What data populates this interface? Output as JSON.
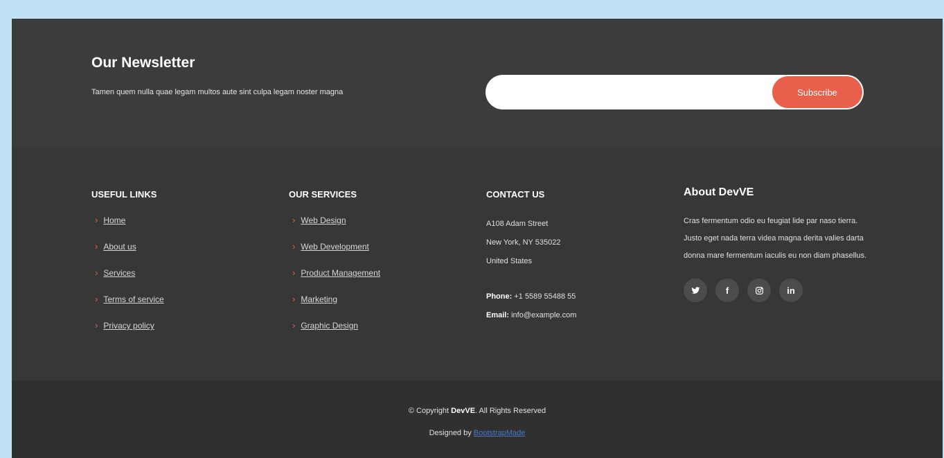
{
  "newsletter": {
    "title": "Our Newsletter",
    "text": "Tamen quem nulla quae legam multos aute sint culpa legam noster magna",
    "input_placeholder": "",
    "button_label": "Subscribe"
  },
  "useful_links": {
    "title": "USEFUL LINKS",
    "items": [
      "Home",
      "About us",
      "Services",
      "Terms of service",
      "Privacy policy"
    ]
  },
  "services": {
    "title": "OUR SERVICES",
    "items": [
      "Web Design",
      "Web Development",
      "Product Management",
      "Marketing",
      "Graphic Design"
    ]
  },
  "contact": {
    "title": "CONTACT US",
    "address_line1": "A108 Adam Street",
    "address_line2": "New York, NY 535022",
    "address_line3": "United States",
    "phone_label": "Phone:",
    "phone": "+1 5589 55488 55",
    "email_label": "Email:",
    "email": "info@example.com"
  },
  "about": {
    "title": "About DevVE",
    "text": "Cras fermentum odio eu feugiat lide par naso tierra. Justo eget nada terra videa magna derita valies darta donna mare fermentum iaculis eu non diam phasellus.",
    "social_icons": [
      "twitter-icon",
      "facebook-icon",
      "instagram-icon",
      "linkedin-icon"
    ]
  },
  "footer": {
    "copyright_prefix": "© Copyright",
    "brand": "DevVE",
    "copyright_suffix": ". All Rights Reserved",
    "designed_by_label": "Designed by",
    "designed_by_link": "BootstrapMade"
  },
  "colors": {
    "accent": "#e8604c",
    "background": "#373737",
    "link": "#4a78c8"
  }
}
